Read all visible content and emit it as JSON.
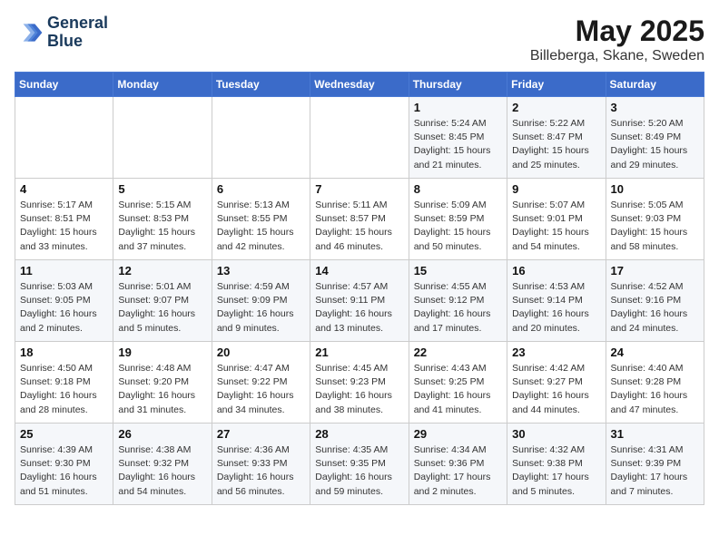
{
  "header": {
    "logo_line1": "General",
    "logo_line2": "Blue",
    "month": "May 2025",
    "location": "Billeberga, Skane, Sweden"
  },
  "days_of_week": [
    "Sunday",
    "Monday",
    "Tuesday",
    "Wednesday",
    "Thursday",
    "Friday",
    "Saturday"
  ],
  "weeks": [
    [
      {
        "num": "",
        "info": ""
      },
      {
        "num": "",
        "info": ""
      },
      {
        "num": "",
        "info": ""
      },
      {
        "num": "",
        "info": ""
      },
      {
        "num": "1",
        "info": "Sunrise: 5:24 AM\nSunset: 8:45 PM\nDaylight: 15 hours\nand 21 minutes."
      },
      {
        "num": "2",
        "info": "Sunrise: 5:22 AM\nSunset: 8:47 PM\nDaylight: 15 hours\nand 25 minutes."
      },
      {
        "num": "3",
        "info": "Sunrise: 5:20 AM\nSunset: 8:49 PM\nDaylight: 15 hours\nand 29 minutes."
      }
    ],
    [
      {
        "num": "4",
        "info": "Sunrise: 5:17 AM\nSunset: 8:51 PM\nDaylight: 15 hours\nand 33 minutes."
      },
      {
        "num": "5",
        "info": "Sunrise: 5:15 AM\nSunset: 8:53 PM\nDaylight: 15 hours\nand 37 minutes."
      },
      {
        "num": "6",
        "info": "Sunrise: 5:13 AM\nSunset: 8:55 PM\nDaylight: 15 hours\nand 42 minutes."
      },
      {
        "num": "7",
        "info": "Sunrise: 5:11 AM\nSunset: 8:57 PM\nDaylight: 15 hours\nand 46 minutes."
      },
      {
        "num": "8",
        "info": "Sunrise: 5:09 AM\nSunset: 8:59 PM\nDaylight: 15 hours\nand 50 minutes."
      },
      {
        "num": "9",
        "info": "Sunrise: 5:07 AM\nSunset: 9:01 PM\nDaylight: 15 hours\nand 54 minutes."
      },
      {
        "num": "10",
        "info": "Sunrise: 5:05 AM\nSunset: 9:03 PM\nDaylight: 15 hours\nand 58 minutes."
      }
    ],
    [
      {
        "num": "11",
        "info": "Sunrise: 5:03 AM\nSunset: 9:05 PM\nDaylight: 16 hours\nand 2 minutes."
      },
      {
        "num": "12",
        "info": "Sunrise: 5:01 AM\nSunset: 9:07 PM\nDaylight: 16 hours\nand 5 minutes."
      },
      {
        "num": "13",
        "info": "Sunrise: 4:59 AM\nSunset: 9:09 PM\nDaylight: 16 hours\nand 9 minutes."
      },
      {
        "num": "14",
        "info": "Sunrise: 4:57 AM\nSunset: 9:11 PM\nDaylight: 16 hours\nand 13 minutes."
      },
      {
        "num": "15",
        "info": "Sunrise: 4:55 AM\nSunset: 9:12 PM\nDaylight: 16 hours\nand 17 minutes."
      },
      {
        "num": "16",
        "info": "Sunrise: 4:53 AM\nSunset: 9:14 PM\nDaylight: 16 hours\nand 20 minutes."
      },
      {
        "num": "17",
        "info": "Sunrise: 4:52 AM\nSunset: 9:16 PM\nDaylight: 16 hours\nand 24 minutes."
      }
    ],
    [
      {
        "num": "18",
        "info": "Sunrise: 4:50 AM\nSunset: 9:18 PM\nDaylight: 16 hours\nand 28 minutes."
      },
      {
        "num": "19",
        "info": "Sunrise: 4:48 AM\nSunset: 9:20 PM\nDaylight: 16 hours\nand 31 minutes."
      },
      {
        "num": "20",
        "info": "Sunrise: 4:47 AM\nSunset: 9:22 PM\nDaylight: 16 hours\nand 34 minutes."
      },
      {
        "num": "21",
        "info": "Sunrise: 4:45 AM\nSunset: 9:23 PM\nDaylight: 16 hours\nand 38 minutes."
      },
      {
        "num": "22",
        "info": "Sunrise: 4:43 AM\nSunset: 9:25 PM\nDaylight: 16 hours\nand 41 minutes."
      },
      {
        "num": "23",
        "info": "Sunrise: 4:42 AM\nSunset: 9:27 PM\nDaylight: 16 hours\nand 44 minutes."
      },
      {
        "num": "24",
        "info": "Sunrise: 4:40 AM\nSunset: 9:28 PM\nDaylight: 16 hours\nand 47 minutes."
      }
    ],
    [
      {
        "num": "25",
        "info": "Sunrise: 4:39 AM\nSunset: 9:30 PM\nDaylight: 16 hours\nand 51 minutes."
      },
      {
        "num": "26",
        "info": "Sunrise: 4:38 AM\nSunset: 9:32 PM\nDaylight: 16 hours\nand 54 minutes."
      },
      {
        "num": "27",
        "info": "Sunrise: 4:36 AM\nSunset: 9:33 PM\nDaylight: 16 hours\nand 56 minutes."
      },
      {
        "num": "28",
        "info": "Sunrise: 4:35 AM\nSunset: 9:35 PM\nDaylight: 16 hours\nand 59 minutes."
      },
      {
        "num": "29",
        "info": "Sunrise: 4:34 AM\nSunset: 9:36 PM\nDaylight: 17 hours\nand 2 minutes."
      },
      {
        "num": "30",
        "info": "Sunrise: 4:32 AM\nSunset: 9:38 PM\nDaylight: 17 hours\nand 5 minutes."
      },
      {
        "num": "31",
        "info": "Sunrise: 4:31 AM\nSunset: 9:39 PM\nDaylight: 17 hours\nand 7 minutes."
      }
    ]
  ]
}
